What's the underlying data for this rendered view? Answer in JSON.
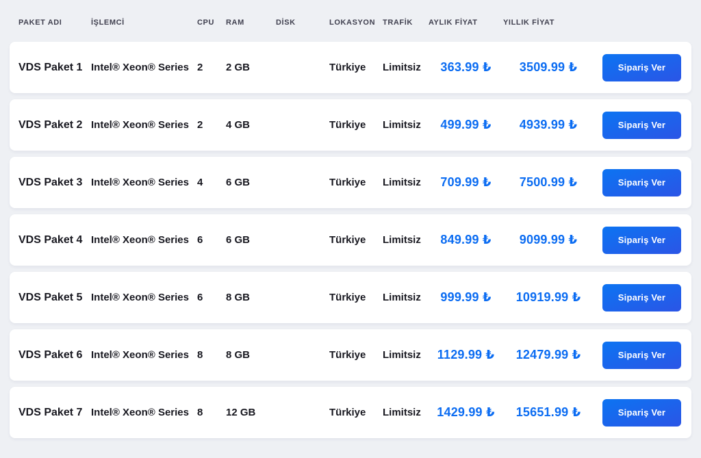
{
  "colors": {
    "page_background": "#eef0f4",
    "card_background": "#ffffff",
    "header_text": "#414150",
    "body_text": "#17171f",
    "price_blue": "#0b6cf2",
    "button_blue_start": "#0c74f2",
    "button_blue_end": "#2b55e6"
  },
  "table": {
    "columns": [
      {
        "label": "PAKET ADI"
      },
      {
        "label": "İŞLEMCİ"
      },
      {
        "label": "CPU"
      },
      {
        "label": "RAM"
      },
      {
        "label": "DİSK"
      },
      {
        "label": "LOKASYON"
      },
      {
        "label": "TRAFİK"
      },
      {
        "label": "AYLIK FİYAT"
      },
      {
        "label": "YILLIK FİYAT"
      }
    ],
    "order_button_label": "Sipariş Ver",
    "rows": [
      {
        "name": "VDS Paket 1",
        "cpu_model": "Intel® Xeon® Series",
        "cpu": "2",
        "ram": "2 GB",
        "disk": "",
        "location": "Türkiye",
        "traffic": "Limitsiz",
        "monthly_price": "363.99 ₺",
        "yearly_price": "3509.99 ₺"
      },
      {
        "name": "VDS Paket 2",
        "cpu_model": "Intel® Xeon® Series",
        "cpu": "2",
        "ram": "4 GB",
        "disk": "",
        "location": "Türkiye",
        "traffic": "Limitsiz",
        "monthly_price": "499.99 ₺",
        "yearly_price": "4939.99 ₺"
      },
      {
        "name": "VDS Paket 3",
        "cpu_model": "Intel® Xeon® Series",
        "cpu": "4",
        "ram": "6 GB",
        "disk": "",
        "location": "Türkiye",
        "traffic": "Limitsiz",
        "monthly_price": "709.99 ₺",
        "yearly_price": "7500.99 ₺"
      },
      {
        "name": "VDS Paket 4",
        "cpu_model": "Intel® Xeon® Series",
        "cpu": "6",
        "ram": "6 GB",
        "disk": "",
        "location": "Türkiye",
        "traffic": "Limitsiz",
        "monthly_price": "849.99 ₺",
        "yearly_price": "9099.99 ₺"
      },
      {
        "name": "VDS Paket 5",
        "cpu_model": "Intel® Xeon® Series",
        "cpu": "6",
        "ram": "8 GB",
        "disk": "",
        "location": "Türkiye",
        "traffic": "Limitsiz",
        "monthly_price": "999.99 ₺",
        "yearly_price": "10919.99 ₺"
      },
      {
        "name": "VDS Paket 6",
        "cpu_model": "Intel® Xeon® Series",
        "cpu": "8",
        "ram": "8 GB",
        "disk": "",
        "location": "Türkiye",
        "traffic": "Limitsiz",
        "monthly_price": "1129.99 ₺",
        "yearly_price": "12479.99 ₺"
      },
      {
        "name": "VDS Paket 7",
        "cpu_model": "Intel® Xeon® Series",
        "cpu": "8",
        "ram": "12 GB",
        "disk": "",
        "location": "Türkiye",
        "traffic": "Limitsiz",
        "monthly_price": "1429.99 ₺",
        "yearly_price": "15651.99 ₺"
      }
    ]
  }
}
